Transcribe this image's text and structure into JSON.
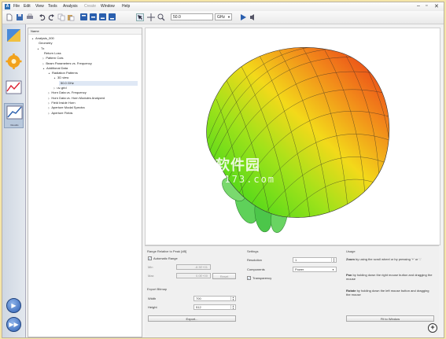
{
  "menu": [
    "File",
    "Edit",
    "View",
    "Tools",
    "Analysis",
    "Create",
    "Window",
    "Help"
  ],
  "toolbar": {
    "frequency_value": "50.0",
    "frequency_unit": "GHz"
  },
  "nav": {
    "results_label": "Results"
  },
  "tree": {
    "header": "Name",
    "nodes": [
      {
        "label": "Analysis_000",
        "twisty": "▲"
      },
      {
        "label": "Geometry",
        "twisty": ""
      },
      {
        "label": "Tx",
        "twisty": "▲"
      },
      {
        "label": "Return Loss",
        "twisty": ""
      },
      {
        "label": "Pattern Cuts",
        "twisty": "▷"
      },
      {
        "label": "Beam Parameters vs. Frequency",
        "twisty": "▷"
      },
      {
        "label": "Additional Data",
        "twisty": "▲"
      },
      {
        "label": "Radiation Patterns",
        "twisty": "▲"
      },
      {
        "label": "3D view",
        "twisty": "▲"
      },
      {
        "label": "50.0 GHz",
        "twisty": ""
      },
      {
        "label": "uv-grid",
        "twisty": "▷"
      },
      {
        "label": "Horn Data vs. Frequency",
        "twisty": "▷"
      },
      {
        "label": "Horn Data vs. Horn Modules Analyzed",
        "twisty": "▷"
      },
      {
        "label": "Field Inside Horn",
        "twisty": "▷"
      },
      {
        "label": "Aperture Modal Spectra",
        "twisty": "▷"
      },
      {
        "label": "Aperture Fields",
        "twisty": "▷"
      }
    ]
  },
  "view": {
    "watermark_cn": "电软件园",
    "watermark_url": "sd173.com"
  },
  "range": {
    "title": "Range Relative to Peak [dB]",
    "automatic_label": "Automatic Range",
    "min_label": "Min",
    "min_value": "-8.3E+01",
    "max_label": "Max",
    "max_value": "0.0E+00",
    "reset_label": "Reset"
  },
  "export": {
    "title": "Export Bitmap",
    "width_label": "Width",
    "width_value": "700",
    "height_label": "Height",
    "height_value": "512",
    "export_label": "Export..."
  },
  "settings": {
    "title": "Settings",
    "resolution_label": "Resolution",
    "resolution_value": "1",
    "components_label": "Components",
    "components_value": "Power",
    "transparency_label": "Transparency"
  },
  "usage": {
    "title": "Usage",
    "zoom_bold": "Zoom",
    "zoom_text": "by using the scroll wheel or by pressing '+' or '-'",
    "pan_bold": "Pan",
    "pan_text": "by holding down the right mouse button and dragging the mouse",
    "rotate_bold": "Rotate",
    "rotate_text": "by holding down the left mouse button and dragging the mouse",
    "fit_label": "Fit to Window"
  },
  "colors": {
    "accent": "#2d6fb3",
    "pattern_hot": "#e8321a",
    "pattern_cold": "#22c61a"
  }
}
